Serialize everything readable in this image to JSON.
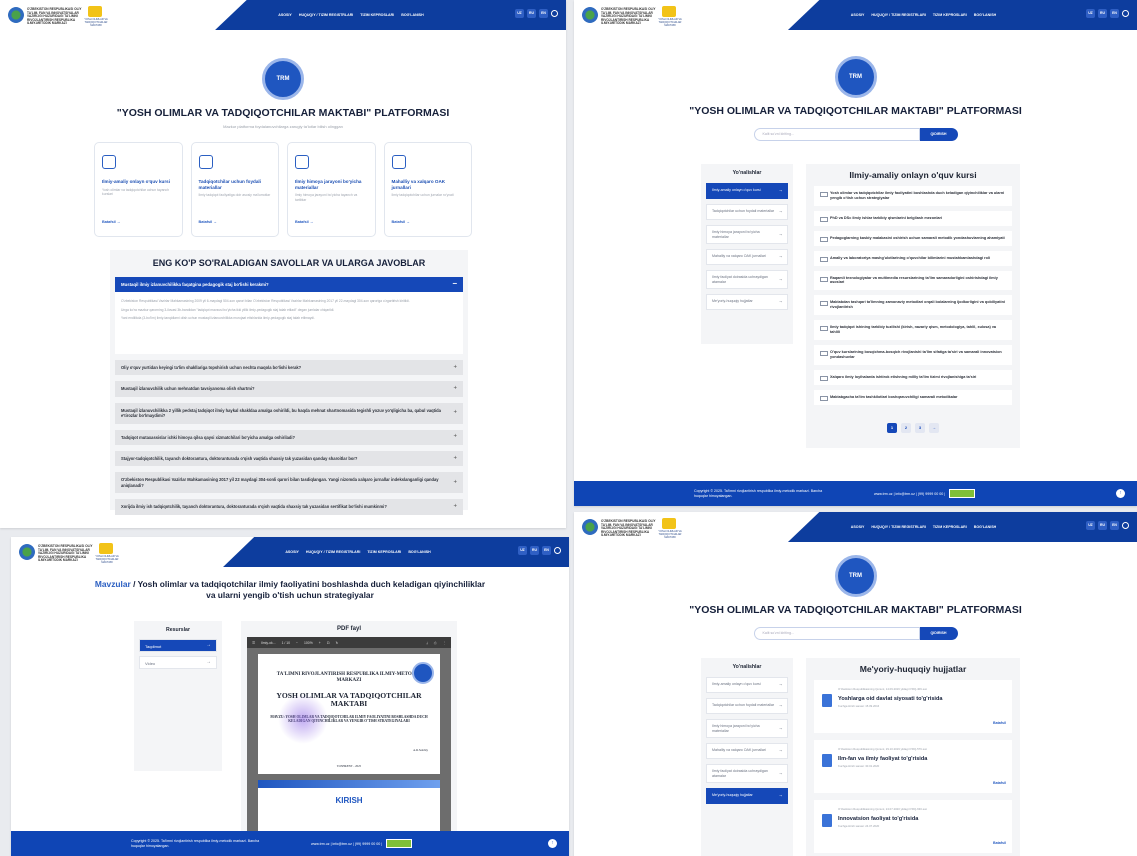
{
  "header": {
    "org_name": "O'ZBEKISTON RESPUBLIKASI OLIY TA'LIM, FAN VA INNOVATSIYALAR VAZIRLIGI HUZURIDAGI TA'LIMNI RIVOJLANTIRISH RESPUBLIKA ILMIY-METODIK MARKAZI",
    "partner_name": "YOSH OLIMLAR VA TADQIQOTCHILAR MAKTABI",
    "nav": [
      "ASOSIY",
      "HUQUQIY / TIZIM REGISTRLARI",
      "TIZIM KEPROSLARI",
      "BOG'LANISH"
    ],
    "langs": [
      "UZ",
      "RU",
      "EN"
    ]
  },
  "platform": {
    "emblem_text": "TRM",
    "title": "\"YOSH OLIMLAR VA TADQIQOTCHILAR MAKTABI\" PLATFORMASI",
    "subtitle": "Mazkur platforma foydalanuvchilarga zarugiy ta'lotlar bilish olinggan"
  },
  "cards": [
    {
      "title": "Ilmiy-amaliy onlayn o'quv kursi",
      "desc": "Yosh olimlar va tadqiqotchilar uchun tayanch kurslari",
      "link": "Batafsil →"
    },
    {
      "title": "Tadqiqotchilar uchun foydali materiallar",
      "desc": "Ilmiy tadqiqot faoliyatiga doir asosiy ma'lumotlar",
      "link": "Batafsil →"
    },
    {
      "title": "Ilmiy himoya jarayoni bo'yicha materiallar",
      "desc": "Ilmiy himoya jarayoni bo'yicha tayanch va tartiblar",
      "link": "Batafsil →"
    },
    {
      "title": "Mahalliy va xalqaro OAK jurnallari",
      "desc": "Ilmiy tadqiqotchilar uchun jurnalar ro'yxati",
      "link": "Batafsil →"
    }
  ],
  "faq": {
    "title": "ENG KO'P SO'RALADIGAN SAVOLLAR VA ULARGA JAVOBLAR",
    "open_question": "Mustaqil ilmiy izlanuvchilikka faqatgina pedagogik staj bo'lishi kerakmi?",
    "answer": [
      "O'zbekiston Respublikasi Vazirlar Mahkamasining 2009 yil 6-maydagi 504-son qarori bilan O'zbekiston Respublikasi Vazirlar Mahkamasining 2017 yil 22-maydagi 304-son qaroriga o'zgartirish kiritildi.",
      "Unga ko'ra mazkur qarorning 3-ilovasi 3b-bandidan \"tadqiqot mavzusi bo'yicha ikki yillik ilmiy-pedagogik staj talab etiladi\" degan jumlalar chiqarildi.",
      "Yani endilikda (3-bo'lim) ilmiy-tanqidlarni olish uchun mustaqil izlanuvchilikka murojaat etishlarida ilmiy-pedagogik staj talab etilmaydi."
    ],
    "questions": [
      "Oliy o'quv yurtidan keyingi ta'lim shakllariga topshirish uchun nechta maqola bo'lishi kerak?",
      "Mustaqil izlanuvchilik uchun mehnatdan tavsiyanoma olish shartmi?",
      "Mustaqil izlanuvchilikka 2 yillik pedstaj tadqiqot ilmiy haykal shakldaa amalga oshirildi, bu haqda mehnat shartnomasida tegishli yozuv yo'qligicha ba, qabul vaqtida e'tirozlar bo'lmaydimi?",
      "Tadqiqot mutaxassislar ichki himoya qilsa qaysi xizmatchilari bo'yicha amalga oshiriladi?",
      "Stajyor-tadqiqotchilik, tayanch doktorantura, doktoranturada o'qish vaqtida shaxsiy tak yuzasidan qanday sharoitlar bor?",
      "O'zbekiston Respublikasi Vazirlar Mahkamasining 2017 yil 22 maydagi 304-sonli qarori bilan tasdiqlangan. Yangi nizomda xalqaro jurnallar indekslanganligi qanday aniqlanadi?",
      "Xorijda ilmiy ish tadqiqotchilik, tayanch doktorantura, doktoranturada o'qish vaqtida shaxsiy tak yuzasidan sertifikat bo'lishi mumkinmi?"
    ]
  },
  "search": {
    "placeholder": "Kalit so'zni kiriting...",
    "button": "QIDIRISH"
  },
  "directions": {
    "title": "Yo'nalishlar",
    "items": [
      "Ilmiy-amaliy onlayn o'quv kursi",
      "Tadqiqotchilar uchun foydali materiallar",
      "Ilmiy himoya jarayoni bo'yicha materiallar",
      "Mahalliy va xalqaro OAK jurnallari",
      "Ilmiy faoliyat doirasida uchraydigan atamalar",
      "Me'yoriy-huquqiy hujjatlar"
    ]
  },
  "course": {
    "title": "Ilmiy-amaliy onlayn o'quv kursi",
    "items": [
      "Yosh olimlar va tadqiqotchilar ilmiy faoliyatini boshlashda duch keladigan qiyinchiliklar va ularni yengib o'tish uchun strategiyalar",
      "PhD va DSc ilmiy ishlar tarkibiy qismlarini belgilash mezonlari",
      "Pedagoglarning kasbiy malakasini oshirish uchun samarali metodik yondashuvlarning ahamiyati",
      "Amaliy va laboratoriya mashg'ulotlarining o'quvchilar bilimlarini mustahkamlashdagi roli",
      "Raqamli texnologiyalar va multimedia resurslarining ta'lim samaradorligini oshirishdagi ilmiy asoslari",
      "Maktabdan tashqari ta'limning zamonaviy metodlari orqali bolalarning ijodkorligini va qobiliyatini rivojlantirish",
      "Ilmiy tadqiqot ishining tarkibiy tuzilishi (kirish, nazariy qism, metodologiya, tahlil, xulosa) va tahlili",
      "O'quv kurslarining bosqichma-bosqich rivojlanishi ta'lim sifatiga ta'siri va samarali innovatsion yondashuvlar",
      "Xalqaro ilmiy loyihalarda ishtirok etishning milliy ta'lim tizimi rivojlanishiga ta'siri",
      "Maktabgacha ta'lim tashkilotlari boshqaruvchiligi samarali metodikalar"
    ],
    "pages": [
      "1",
      "2",
      "3",
      "→"
    ]
  },
  "resource_page": {
    "breadcrumb": "Mavzular",
    "separator": " / ",
    "title": "Yosh olimlar va tadqiqotchilar ilmiy faoliyatini boshlashda duch keladigan qiyinchiliklar va ularni yengib o'tish uchun strategiyalar",
    "resources_title": "Resurslar",
    "resources": [
      "Taqdimot",
      "Video"
    ],
    "pdf_title": "PDF fayl",
    "pdf_toolbar_name": "Ilmiy-ok...",
    "pdf_page": "1 / 10",
    "pdf_zoom": "100%",
    "doc_org": "TA'LIMNI RIVOJLANTIRISH RESPUBLIKA ILMIY-METODIK MARKAZI",
    "doc_title": "YOSH OLIMLAR VA TADQIQOTCHILAR MAKTABI",
    "doc_subtitle": "MAVZU: YOSH OLIMLAR VA TADQIQOTCHILAR ILMIY FAOLIYATINI BOSHLASHDA DUCH KELADIGAN QIYINCHILIKLAR VA YENGIB O'TISH STRATEGIYALARI",
    "doc_author": "A.R.Salohiy",
    "doc_year": "TOSHKENT - 2025",
    "doc_page2": "KIRISH"
  },
  "laws": {
    "title": "Me'yoriy-huquqiy hujjatlar",
    "items": [
      {
        "meta": "O'zbekiston Respublikasining Qonuni, 14.09.2016 yildagi O'RQ-406-son",
        "title": "Yoshlarga oid davlat siyosati to'g'risida",
        "date": "Kuchga kirish sanasi: 15.09.2016",
        "more": "Batafsil"
      },
      {
        "meta": "O'zbekiston Respublikasining Qonuni, 29.10.2019 yildagi O'RQ-576-son",
        "title": "Ilm-fan va ilmiy faoliyat to'g'risida",
        "date": "Kuchga kirish sanasi: 30.01.2020",
        "more": "Batafsil"
      },
      {
        "meta": "O'zbekiston Respublikasining Qonuni, 24.07.2020 yildagi O'RQ-630-son",
        "title": "Innovatsion faoliyat to'g'risida",
        "date": "Kuchga kirish sanasi: 24.07.2020",
        "more": "Batafsil"
      }
    ]
  },
  "footer": {
    "copyright": "Copyright © 2025. Ta'limni rivojlantirish respublika ilmiy-metodik markazi. Barcha huquqlar himoyalangan.",
    "contacts": "www.trm.uz  |  info@trm.uz  |  (99) 9999 00 00  |",
    "up": "↑"
  },
  "colors": {
    "primary": "#1548b8",
    "header_bar": "#0d3d9e",
    "panel": "#f4f5f7",
    "badge": "#7fbf38"
  }
}
